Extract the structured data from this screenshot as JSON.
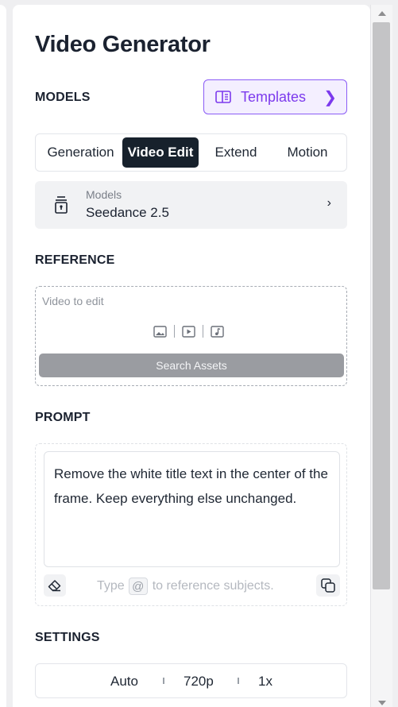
{
  "panel": {
    "title": "Video Generator"
  },
  "models_section": {
    "label": "MODELS",
    "templates_button": {
      "label": "Templates",
      "icon": "book-open-icon",
      "chevron": "❯"
    },
    "tabs": [
      {
        "label": "Generation",
        "active": false
      },
      {
        "label": "Video Edit",
        "active": true
      },
      {
        "label": "Extend",
        "active": false
      },
      {
        "label": "Motion",
        "active": false
      }
    ],
    "model_picker": {
      "label": "Models",
      "value": "Seedance 2.5",
      "icon": "model-icon",
      "chevron": "›"
    }
  },
  "reference_section": {
    "label": "REFERENCE",
    "placeholder": "Video to edit",
    "icons": [
      "image-icon",
      "video-icon",
      "audio-icon"
    ],
    "search_button": "Search Assets"
  },
  "prompt_section": {
    "label": "PROMPT",
    "value": "Remove the white title text in the center of the frame. Keep everything else unchanged.",
    "hint_before": "Type",
    "hint_token": "@",
    "hint_after": "to reference subjects."
  },
  "settings_section": {
    "label": "SETTINGS",
    "options": [
      "Auto",
      "720p",
      "1x"
    ]
  },
  "colors": {
    "accent": "#7c3aed",
    "active_tab": "#17212c"
  }
}
